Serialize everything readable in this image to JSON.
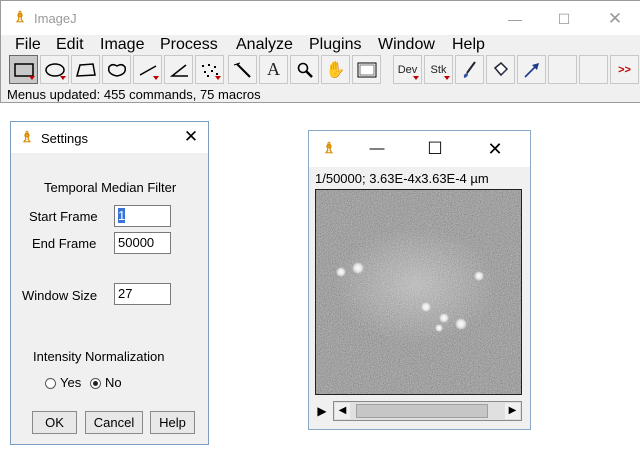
{
  "main_window": {
    "title": "ImageJ",
    "menus": [
      "File",
      "Edit",
      "Image",
      "Process",
      "Analyze",
      "Plugins",
      "Window",
      "Help"
    ],
    "tools": {
      "dev": "Dev",
      "stk": "Stk",
      "more": ">>"
    },
    "status": "Menus updated: 455 commands, 75 macros"
  },
  "settings_dialog": {
    "title": "Settings",
    "heading": "Temporal Median Filter",
    "start_frame_label": "Start Frame",
    "start_frame_value": "1",
    "end_frame_label": "End Frame",
    "end_frame_value": "50000",
    "window_size_label": "Window Size",
    "window_size_value": "27",
    "intensity_label": "Intensity Normalization",
    "yes_label": "Yes",
    "no_label": "No",
    "intensity_selected": "No",
    "ok_label": "OK",
    "cancel_label": "Cancel",
    "help_label": "Help"
  },
  "image_window": {
    "info": "1/50000; 3.63E-4x3.63E-4 µm"
  },
  "colors": {
    "menu_tool_triangle": "#c00000",
    "selection_blue": "#3875d7",
    "icon_orange": "#d98c00"
  }
}
